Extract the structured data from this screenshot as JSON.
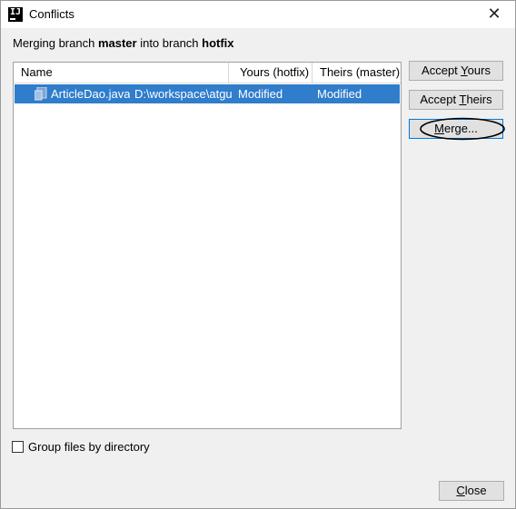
{
  "window": {
    "title": "Conflicts",
    "app_icon_text": "IJ"
  },
  "heading": {
    "prefix": "Merging branch ",
    "source": "master",
    "middle": " into branch ",
    "target": "hotfix"
  },
  "table": {
    "columns": [
      "Name",
      "Yours (hotfix)",
      "Theirs (master)"
    ],
    "rows": [
      {
        "file_name": "ArticleDao.java",
        "path": "D:\\workspace\\atgu",
        "yours": "Modified",
        "theirs": "Modified",
        "selected": true
      }
    ]
  },
  "buttons": {
    "accept_yours": {
      "before": "Accept ",
      "mnemonic": "Y",
      "after": "ours"
    },
    "accept_theirs": {
      "before": "Accept ",
      "mnemonic": "T",
      "after": "heirs"
    },
    "merge": {
      "before": "",
      "mnemonic": "M",
      "after": "erge..."
    },
    "close": {
      "before": "",
      "mnemonic": "C",
      "after": "lose"
    }
  },
  "options": {
    "group_by_directory": {
      "label": "Group files by directory",
      "checked": false
    }
  },
  "colors": {
    "selection": "#2f7dcb",
    "dialog_bg": "#f0f0f0",
    "annotation_ellipse": "#000000"
  }
}
